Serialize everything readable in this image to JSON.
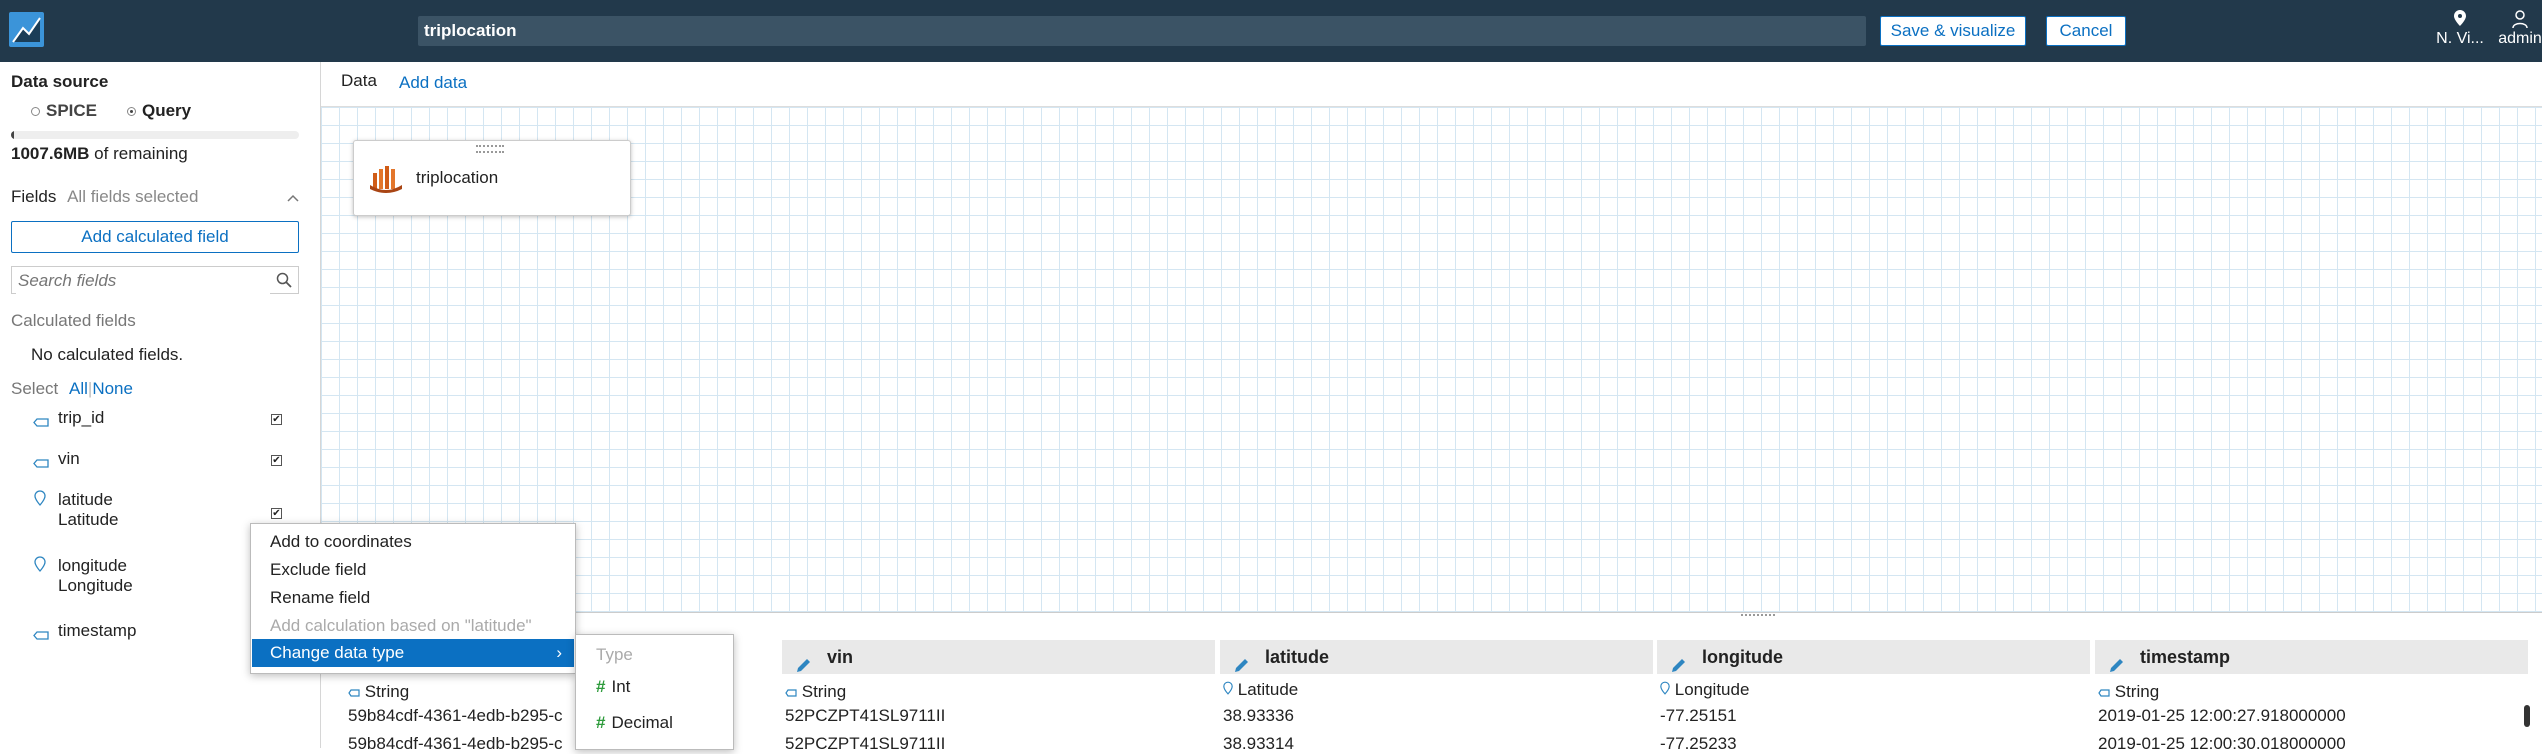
{
  "header": {
    "dataset_name": "triplocation",
    "save_label": "Save & visualize",
    "cancel_label": "Cancel",
    "region": "N. Vi...",
    "user": "admin"
  },
  "sidebar": {
    "data_source_label": "Data source",
    "spice_label": "SPICE",
    "query_label": "Query",
    "remaining_value": "1007.6MB",
    "remaining_suffix": "of remaining",
    "fields_label": "Fields",
    "fields_selected": "All fields selected",
    "add_calc_label": "Add calculated field",
    "search_placeholder": "Search fields",
    "calc_header": "Calculated fields",
    "no_calc": "No calculated fields.",
    "select_label": "Select",
    "select_all": "All",
    "select_none": "None",
    "fields": [
      {
        "name": "trip_id",
        "sub": ""
      },
      {
        "name": "vin",
        "sub": ""
      },
      {
        "name": "latitude",
        "sub": "Latitude"
      },
      {
        "name": "longitude",
        "sub": "Longitude"
      },
      {
        "name": "timestamp",
        "sub": ""
      }
    ]
  },
  "main": {
    "tab_data": "Data",
    "tab_add": "Add data",
    "card_name": "triplocation"
  },
  "context_menu": {
    "items": [
      "Add to coordinates",
      "Exclude field",
      "Rename field",
      "Add calculation based on \"latitude\"",
      "Change data type"
    ],
    "sub_header": "Type",
    "sub_options": [
      "Int",
      "Decimal"
    ]
  },
  "preview": {
    "columns": [
      {
        "name": "vin",
        "type": "String",
        "values": [
          "52PCZPT41SL9711II",
          "52PCZPT41SL9711II"
        ]
      },
      {
        "name": "latitude",
        "type": "Latitude",
        "values": [
          "38.93336",
          "38.93314"
        ]
      },
      {
        "name": "longitude",
        "type": "Longitude",
        "values": [
          "-77.25151",
          "-77.25233"
        ]
      },
      {
        "name": "timestamp",
        "type": "String",
        "values": [
          "2019-01-25 12:00:27.918000000",
          "2019-01-25 12:00:30.018000000"
        ]
      }
    ],
    "first_col": {
      "type": "String",
      "values": [
        "59b84cdf-4361-4edb-b295-c",
        "59b84cdf-4361-4edb-b295-c"
      ]
    }
  }
}
